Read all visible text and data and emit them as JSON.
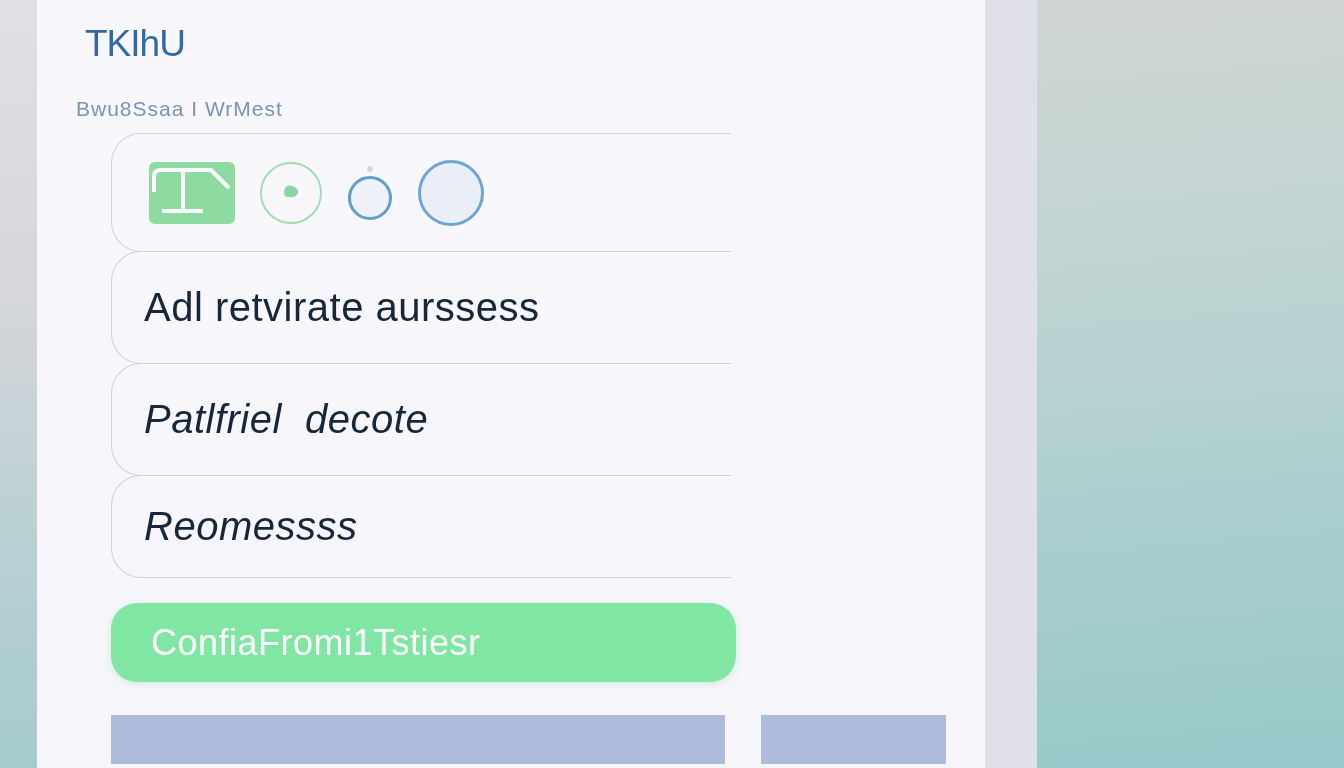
{
  "header": {
    "title": "TKIhU",
    "subtitle": "Bwu8Ssaa I WrMest"
  },
  "options": [
    {
      "label": "Adl retvirate aurssess"
    },
    {
      "label": "Patlfriel  decote"
    },
    {
      "label": "Reomessss"
    }
  ],
  "confirm_button": {
    "label": "ConfiaFromi1Tstiesr"
  }
}
